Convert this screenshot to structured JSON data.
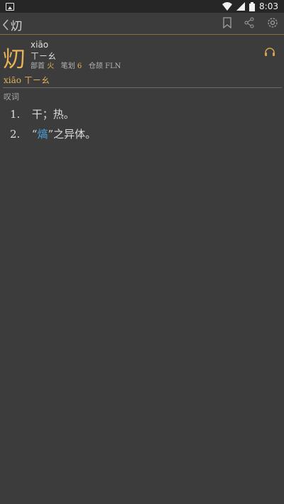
{
  "statusbar": {
    "time": "8:03"
  },
  "toolbar": {
    "title": "灱"
  },
  "entry": {
    "character": "灱",
    "pinyin": "xiāo",
    "zhuyin": "ㄒㄧㄠ",
    "radical_label": "部首",
    "radical": "火",
    "strokes_label": "笔划",
    "strokes": "6",
    "cangjie_label": "仓颉",
    "cangjie": "FLN"
  },
  "reading": {
    "pinyin": "xiāo",
    "zhuyin": "ㄒㄧㄠ"
  },
  "pos_label": "叹词",
  "definitions": [
    {
      "num": "1.",
      "text": "干；热。"
    },
    {
      "num": "2.",
      "pre": "“",
      "link": "熇",
      "post": "”之异体。"
    }
  ]
}
